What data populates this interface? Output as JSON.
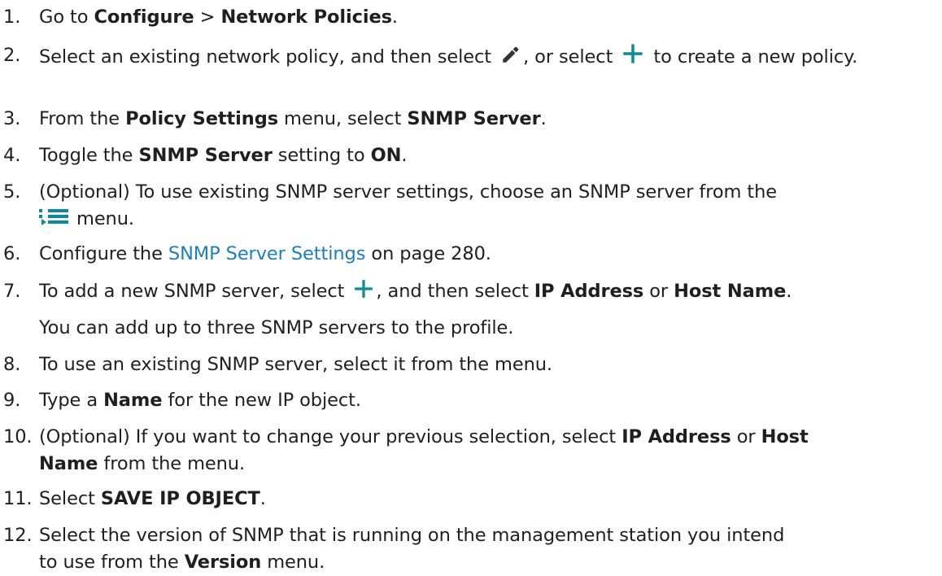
{
  "steps": [
    {
      "num": "1.",
      "parts": [
        "Go to ",
        "Configure",
        " > ",
        "Network Policies",
        "."
      ]
    },
    {
      "num": "2.",
      "parts": [
        "Select an existing network policy, and then select ",
        ", or select ",
        " to create a new policy."
      ]
    },
    {
      "num": "3.",
      "parts": [
        "From the ",
        "Policy Settings",
        " menu, select ",
        "SNMP Server",
        "."
      ]
    },
    {
      "num": "4.",
      "parts": [
        "Toggle the ",
        "SNMP Server",
        " setting to ",
        "ON",
        "."
      ]
    },
    {
      "num": "5.",
      "parts": [
        "(Optional) To use existing SNMP server settings, choose an SNMP server from the",
        "menu."
      ]
    },
    {
      "num": "6.",
      "parts": [
        "Configure the ",
        "SNMP Server Settings",
        " on page 280."
      ]
    },
    {
      "num": "7.",
      "parts": [
        "To add a new SNMP server, select ",
        ", and then select ",
        "IP Address",
        " or ",
        "Host Name",
        "."
      ],
      "note": "You can add up to three SNMP servers to the profile."
    },
    {
      "num": "8.",
      "parts": [
        "To use an existing SNMP server, select it from the menu."
      ]
    },
    {
      "num": "9.",
      "parts": [
        "Type a ",
        "Name",
        " for the new IP object."
      ]
    },
    {
      "num": "10.",
      "parts": [
        "(Optional) If you want to change your previous selection, select ",
        "IP Address",
        " or ",
        "Host",
        "Name",
        " from the menu."
      ]
    },
    {
      "num": "11.",
      "parts": [
        "Select ",
        "SAVE IP OBJECT",
        "."
      ]
    },
    {
      "num": "12.",
      "parts": [
        "Select the version of SNMP that is running on the management station you intend",
        "to use from the ",
        "Version",
        " menu."
      ]
    }
  ],
  "colors": {
    "text": "#1f1f1f",
    "link": "#1a7fc1",
    "icon_teal": "#0b8c95",
    "icon_dark": "#333333"
  },
  "icons": [
    "pencil-icon",
    "plus-icon",
    "list-menu-icon"
  ]
}
